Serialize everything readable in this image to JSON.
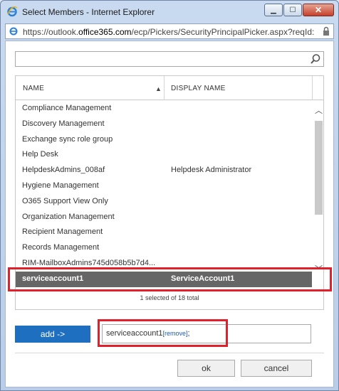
{
  "window": {
    "title": "Select Members - Internet Explorer",
    "buttons": {
      "minimize": "▁",
      "maximize": "☐",
      "close": "✕"
    }
  },
  "address": {
    "url_prefix": "https://outlook.",
    "url_domain": "office365.com",
    "url_suffix": "/ecp/Pickers/SecurityPrincipalPicker.aspx?reqId:"
  },
  "search": {
    "value": "",
    "placeholder": ""
  },
  "table": {
    "headers": {
      "name": "NAME",
      "display_name": "DISPLAY NAME"
    },
    "rows": [
      {
        "name": "Compliance Management",
        "display": ""
      },
      {
        "name": "Discovery Management",
        "display": ""
      },
      {
        "name": "Exchange sync role group",
        "display": ""
      },
      {
        "name": "Help Desk",
        "display": ""
      },
      {
        "name": "HelpdeskAdmins_008af",
        "display": "Helpdesk Administrator"
      },
      {
        "name": "Hygiene Management",
        "display": ""
      },
      {
        "name": "O365 Support View Only",
        "display": ""
      },
      {
        "name": "Organization Management",
        "display": ""
      },
      {
        "name": "Recipient Management",
        "display": ""
      },
      {
        "name": "Records Management",
        "display": ""
      },
      {
        "name": "RIM-MailboxAdmins745d058b5b7d4...",
        "display": ""
      },
      {
        "name": "serviceaccount1",
        "display": "ServiceAccount1"
      }
    ],
    "selection_status": "1 selected of 18 total"
  },
  "add_button": "add ->",
  "members": {
    "value": "serviceaccount1",
    "remove_label": "[remove]",
    "trailing": ";"
  },
  "footer": {
    "ok": "ok",
    "cancel": "cancel"
  },
  "colors": {
    "accent": "#1e6fc0",
    "selection": "#666666",
    "highlight_box": "#e0202a"
  }
}
